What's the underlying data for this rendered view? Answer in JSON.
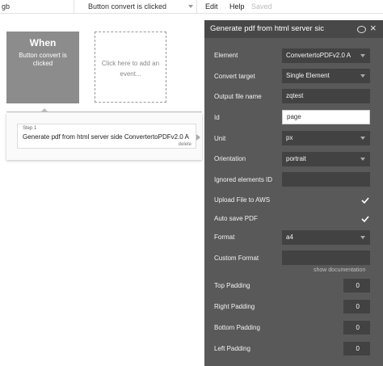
{
  "topbar": {
    "page_select": "gb",
    "event_select": "Button convert is clicked",
    "menu_edit": "Edit",
    "menu_help": "Help",
    "saved_label": "Saved"
  },
  "event_card": {
    "title": "When",
    "description": "Button convert is clicked"
  },
  "add_event": {
    "text_line1": "Click here to add an",
    "text_line2": "event..."
  },
  "step": {
    "label": "Step 1",
    "title": "Generate pdf from html server side ConvertertoPDFv2.0 A",
    "delete_label": "delete"
  },
  "panel": {
    "title": "Generate pdf from html server sic",
    "rows": {
      "element": {
        "label": "Element",
        "value": "ConvertertoPDFv2.0 A"
      },
      "convert_target": {
        "label": "Convert target",
        "value": "Single Element"
      },
      "output_file_name": {
        "label": "Output file name",
        "value": "zqtest"
      },
      "id": {
        "label": "Id",
        "value": "page"
      },
      "unit": {
        "label": "Unit",
        "value": "px"
      },
      "orientation": {
        "label": "Orientation",
        "value": "portrait"
      },
      "ignored_elements": {
        "label": "Ignored elements ID",
        "value": ""
      },
      "upload_aws": {
        "label": "Upload File to AWS",
        "checked": true
      },
      "auto_save": {
        "label": "Auto save PDF",
        "checked": true
      },
      "format": {
        "label": "Format",
        "value": "a4"
      },
      "custom_format": {
        "label": "Custom Format",
        "value": ""
      },
      "show_documentation": "show documentation",
      "top_padding": {
        "label": "Top Padding",
        "value": "0"
      },
      "right_padding": {
        "label": "Right Padding",
        "value": "0"
      },
      "bottom_padding": {
        "label": "Bottom Padding",
        "value": "0"
      },
      "left_padding": {
        "label": "Left Padding",
        "value": "0"
      }
    }
  }
}
